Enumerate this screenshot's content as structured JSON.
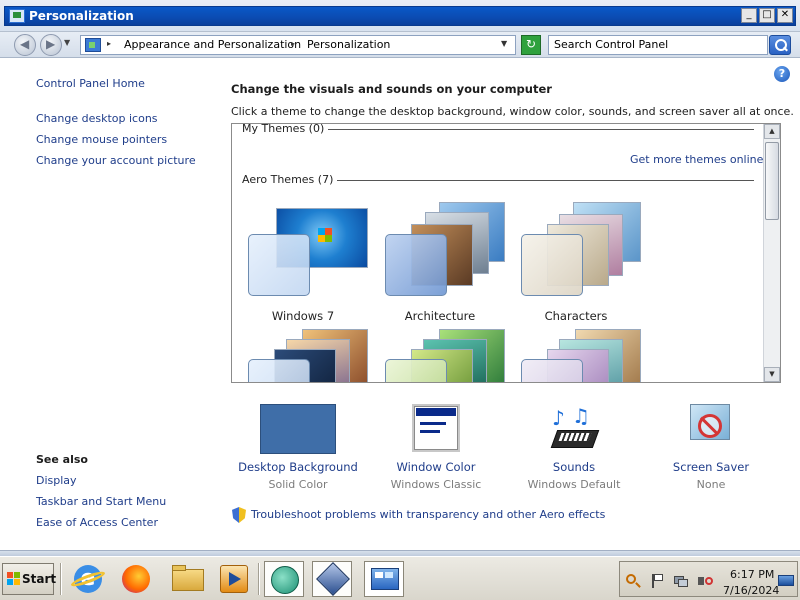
{
  "window": {
    "title": "Personalization"
  },
  "addressbar": {
    "crumbs": [
      "Appearance and Personalization",
      "Personalization"
    ],
    "search_placeholder": "Search Control Panel"
  },
  "sidebar": {
    "home": "Control Panel Home",
    "links": [
      "Change desktop icons",
      "Change mouse pointers",
      "Change your account picture"
    ],
    "see_also_title": "See also",
    "see_also": [
      "Display",
      "Taskbar and Start Menu",
      "Ease of Access Center"
    ]
  },
  "main": {
    "title": "Change the visuals and sounds on your computer",
    "description": "Click a theme to change the desktop background, window color, sounds, and screen saver all at once.",
    "my_themes": "My Themes (0)",
    "get_more": "Get more themes online",
    "aero_themes": "Aero Themes (7)",
    "themes": [
      {
        "name": "Windows 7"
      },
      {
        "name": "Architecture"
      },
      {
        "name": "Characters"
      },
      {
        "name": ""
      },
      {
        "name": ""
      },
      {
        "name": ""
      }
    ]
  },
  "options": [
    {
      "name": "Desktop Background",
      "value": "Solid Color",
      "icon": "desktop-background-icon"
    },
    {
      "name": "Window Color",
      "value": "Windows Classic",
      "icon": "window-color-icon"
    },
    {
      "name": "Sounds",
      "value": "Windows Default",
      "icon": "sounds-icon"
    },
    {
      "name": "Screen Saver",
      "value": "None",
      "icon": "screen-saver-icon"
    }
  ],
  "troubleshoot": "Troubleshoot problems with transparency and other Aero effects",
  "taskbar": {
    "start_label": "Start",
    "apps": [
      "internet-explorer-icon",
      "firefox-icon",
      "file-explorer-icon",
      "media-player-icon",
      "app-icon",
      "virtualbox-icon",
      "control-panel-icon"
    ],
    "clock_time": "6:17 PM",
    "clock_date": "7/16/2024"
  },
  "colors": {
    "link": "#1f3d8a",
    "desktop_background_swatch": "#3f6ea8",
    "title_bar": "#0b4bb1"
  }
}
